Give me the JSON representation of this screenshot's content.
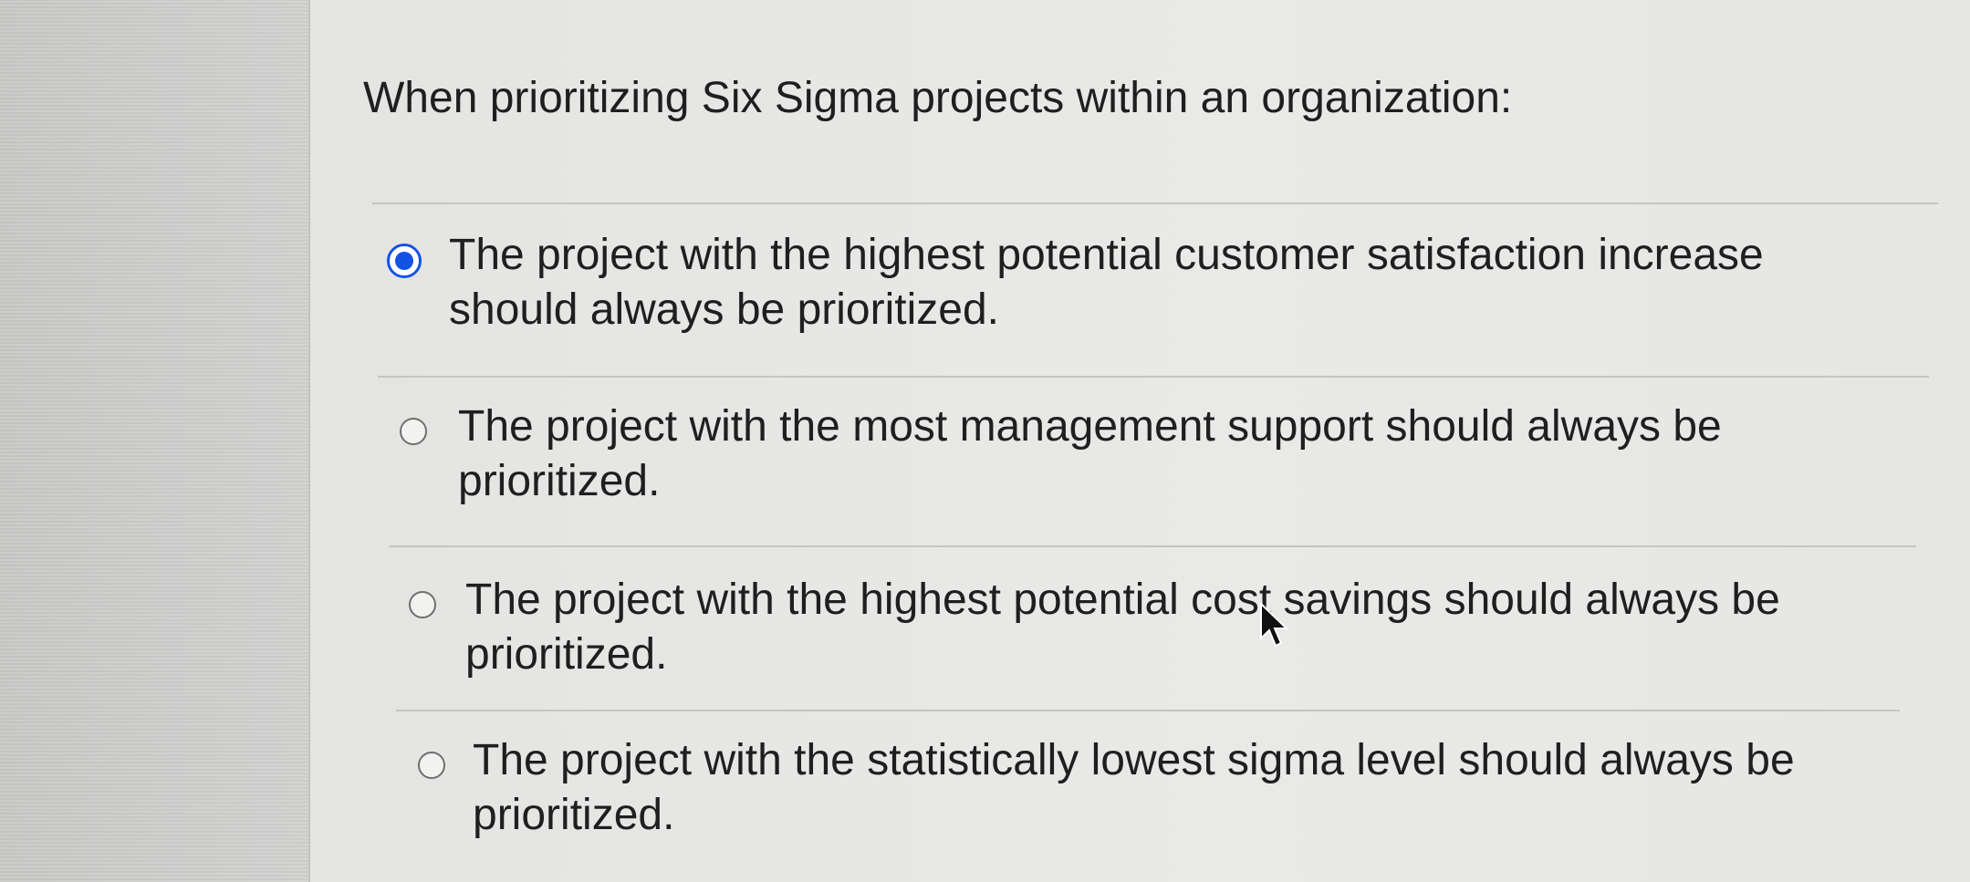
{
  "question": {
    "text": "When prioritizing Six Sigma projects within an organization:"
  },
  "options": [
    {
      "line1": "The project with the highest potential customer satisfaction increase",
      "line2": "should always be prioritized.",
      "selected": true
    },
    {
      "line1": "The project with the most management support should always be",
      "line2": "prioritized.",
      "selected": false
    },
    {
      "line1": "The project with the highest potential cost savings should always be",
      "line2": "prioritized.",
      "selected": false
    },
    {
      "line1": "The project with the statistically lowest sigma level should always be",
      "line2": "prioritized.",
      "selected": false
    }
  ],
  "colors": {
    "selected_radio": "#1452e6",
    "text": "#1f1f1f"
  },
  "icons": {
    "radio_selected": "radio-selected-icon",
    "radio_unselected": "radio-unselected-icon",
    "pointer": "mouse-pointer-icon"
  }
}
